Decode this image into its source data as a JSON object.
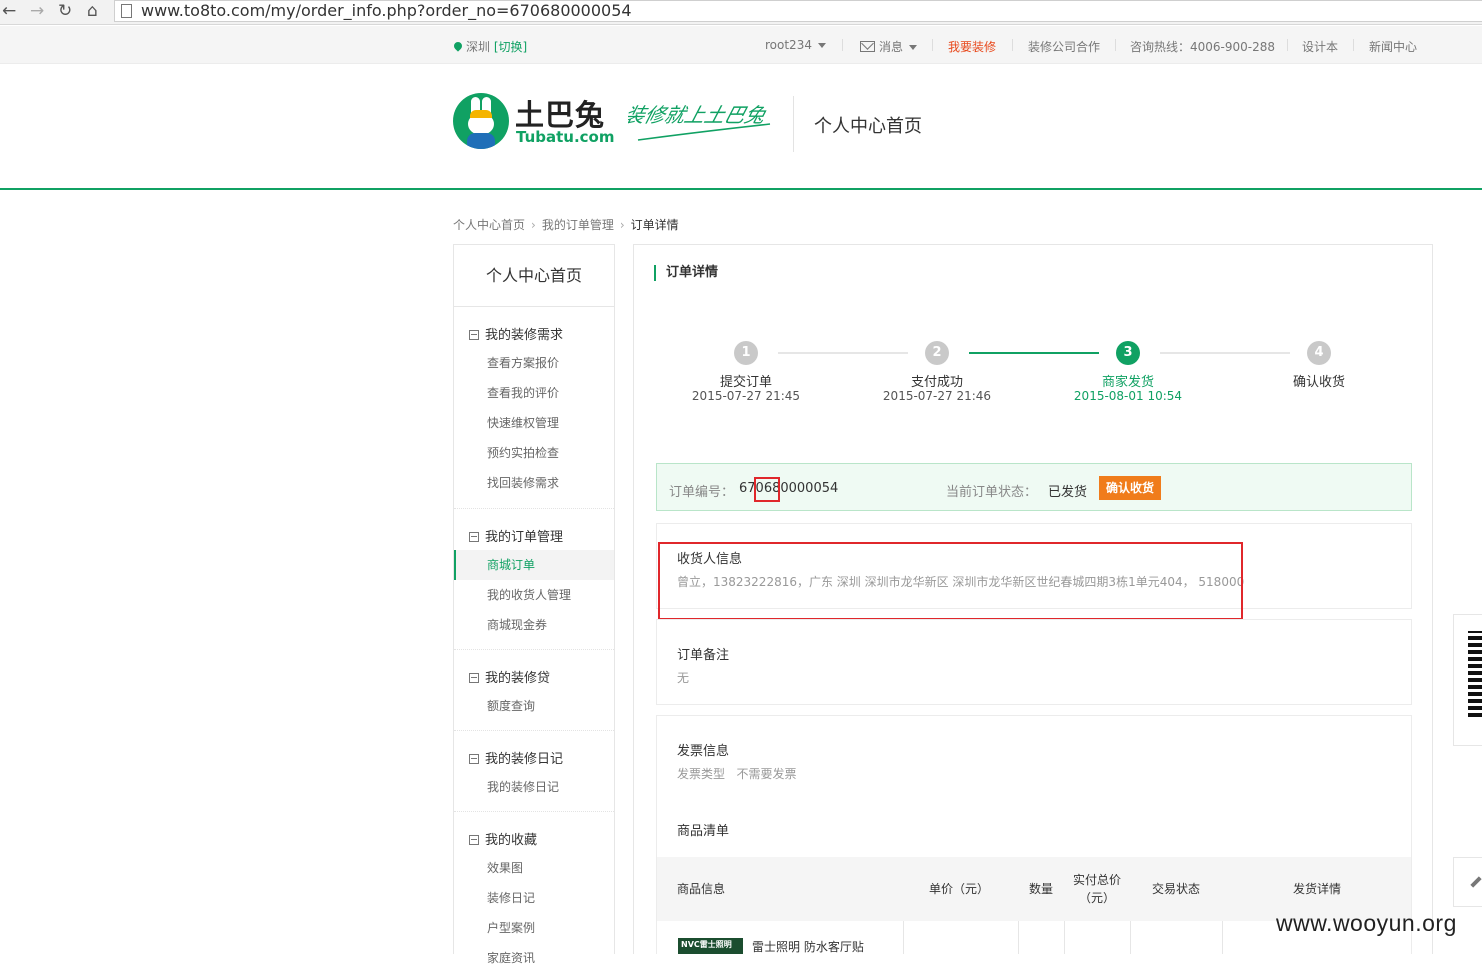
{
  "browser": {
    "url": "www.to8to.com/my/order_info.php?order_no=670680000054",
    "nav_icons": [
      "back-arrow-icon",
      "forward-arrow-icon",
      "reload-icon",
      "home-icon"
    ]
  },
  "topbar": {
    "city": "深圳",
    "switch_label": "[切换]",
    "username": "root234",
    "messages_label": "消息",
    "renovate_label": "我要装修",
    "partner_label": "装修公司合作",
    "hotline": "咨询热线：4006-900-288",
    "designer_label": "设计本",
    "news_label": "新闻中心",
    "accent_color": "#e8481b"
  },
  "header": {
    "logo_cn": "土巴兔",
    "logo_en": "Tubatu.com",
    "slogan": "装修就上土巴兔",
    "section_title": "个人中心首页",
    "brand_color": "#10a163"
  },
  "breadcrumb": {
    "items": [
      "个人中心首页",
      "我的订单管理",
      "订单详情"
    ],
    "separator": ">"
  },
  "sidebar": {
    "home_label": "个人中心首页",
    "groups": [
      {
        "title": "我的装修需求",
        "items": [
          "查看方案报价",
          "查看我的评价",
          "快速维权管理",
          "预约实拍检查",
          "找回装修需求"
        ]
      },
      {
        "title": "我的订单管理",
        "items": [
          "商城订单",
          "我的收货人管理",
          "商城现金券"
        ],
        "active_index": 0
      },
      {
        "title": "我的装修贷",
        "items": [
          "额度查询"
        ]
      },
      {
        "title": "我的装修日记",
        "items": [
          "我的装修日记"
        ]
      },
      {
        "title": "我的收藏",
        "items": [
          "效果图",
          "装修日记",
          "户型案例",
          "家庭资讯"
        ]
      }
    ]
  },
  "main": {
    "title": "订单详情",
    "steps": [
      {
        "num": "1",
        "label": "提交订单",
        "time": "2015-07-27 21:45"
      },
      {
        "num": "2",
        "label": "支付成功",
        "time": "2015-07-27 21:46"
      },
      {
        "num": "3",
        "label": "商家发货",
        "time": "2015-08-01 10:54",
        "active": true
      },
      {
        "num": "4",
        "label": "确认收货",
        "time": ""
      }
    ],
    "order": {
      "no_label": "订单编号：",
      "no_value": "670680000054",
      "status_label": "当前订单状态：",
      "status_value": "已发货",
      "confirm_button": "确认收货"
    },
    "consignee": {
      "title": "收货人信息",
      "text": "曾立，13823222816，广东 深圳 深圳市龙华新区 深圳市龙华新区世纪春城四期3栋1单元404， 518000"
    },
    "remark": {
      "title": "订单备注",
      "text": "无"
    },
    "invoice": {
      "title": "发票信息",
      "type_label": "发票类型",
      "type_value": "不需要发票"
    },
    "products": {
      "title": "商品清单",
      "headers": [
        "商品信息",
        "单价（元）",
        "数量",
        "实付总价\n（元）",
        "交易状态",
        "发货详情"
      ],
      "rows": [
        {
          "thumb_text": "NVC雷士照明",
          "name": "雷士照明 防水客厅贴"
        }
      ]
    }
  },
  "watermark": "www.wooyun.org"
}
